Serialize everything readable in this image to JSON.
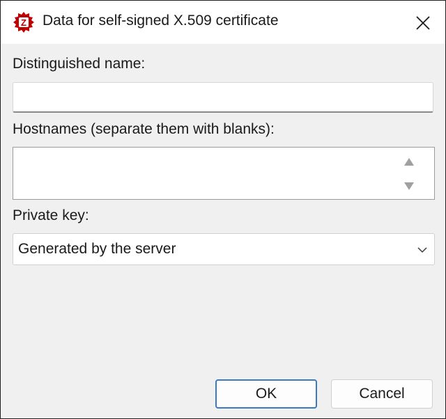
{
  "window": {
    "title": "Data for self-signed X.509 certificate"
  },
  "form": {
    "distinguished_name_label": "Distinguished name:",
    "distinguished_name_value": "",
    "hostnames_label": "Hostnames (separate them with blanks):",
    "hostnames_value": "",
    "private_key_label": "Private key:",
    "private_key_selected": "Generated by the server"
  },
  "buttons": {
    "ok_label": "OK",
    "cancel_label": "Cancel"
  },
  "icons": {
    "app": "filezilla-logo-icon",
    "close": "close-icon",
    "scroll_up": "scroll-up-arrow-icon",
    "scroll_down": "scroll-down-arrow-icon",
    "dropdown": "chevron-down-icon"
  },
  "colors": {
    "app_icon_red": "#bf0000",
    "focus_blue": "#3b78c6",
    "dialog_bg": "#f0f0f0"
  }
}
